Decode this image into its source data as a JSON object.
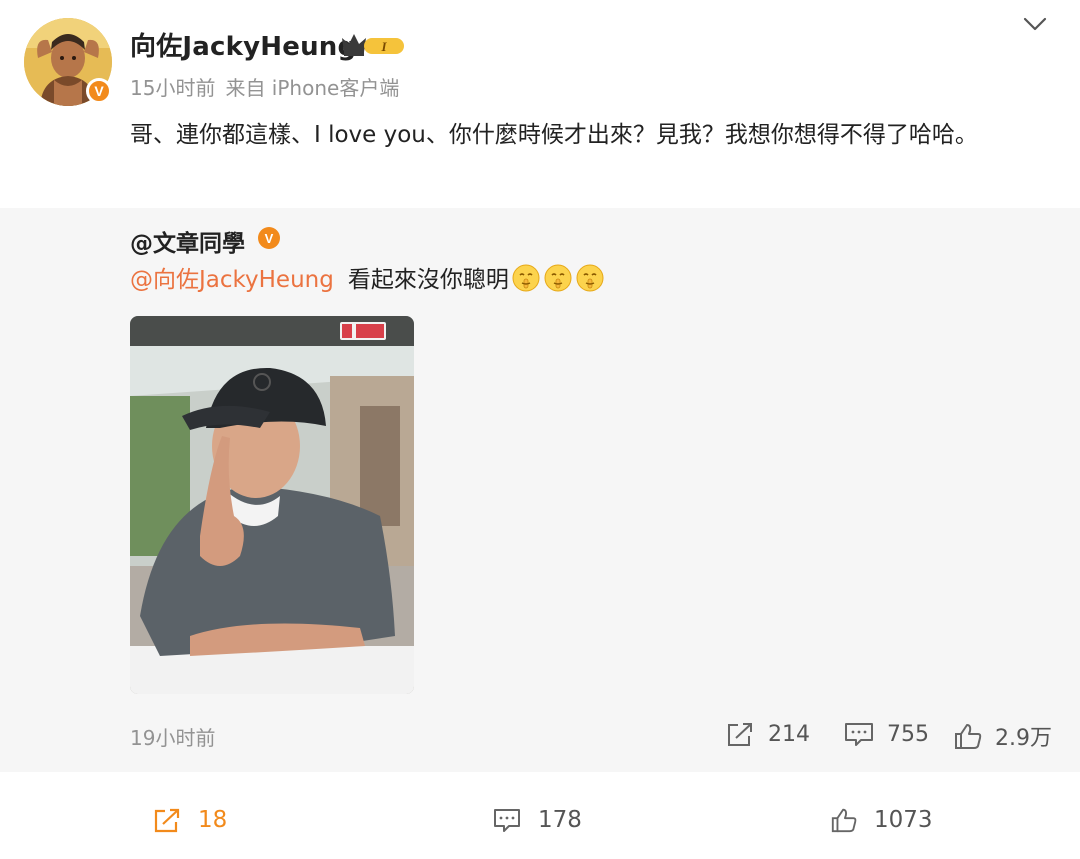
{
  "post": {
    "author": "向佐JackyHeung",
    "vip_badge_text": "I",
    "time": "15小时前",
    "source": "来自 iPhone客户端",
    "text": "哥、連你都這樣、I love you、你什麼時候才出來？見我？我想你想得不得了哈哈。"
  },
  "repost": {
    "author": "@文章同學",
    "mention": "@向佐JackyHeung",
    "text": "看起來沒你聰明",
    "time": "19小时前",
    "share_count": "214",
    "comment_count": "755",
    "like_count": "2.9万"
  },
  "bottom": {
    "share_count": "18",
    "comment_count": "178",
    "like_count": "1073"
  },
  "colors": {
    "accent_orange": "#f28a1b",
    "mention": "#eb7340",
    "meta_gray": "#939393"
  },
  "icons": {
    "more": "chevron-down-icon",
    "share": "share-icon",
    "comment": "comment-icon",
    "like": "thumbs-up-icon",
    "verified": "verified-v-icon",
    "vip": "crown-vip-icon",
    "emoji": "shush-emoji-icon"
  }
}
